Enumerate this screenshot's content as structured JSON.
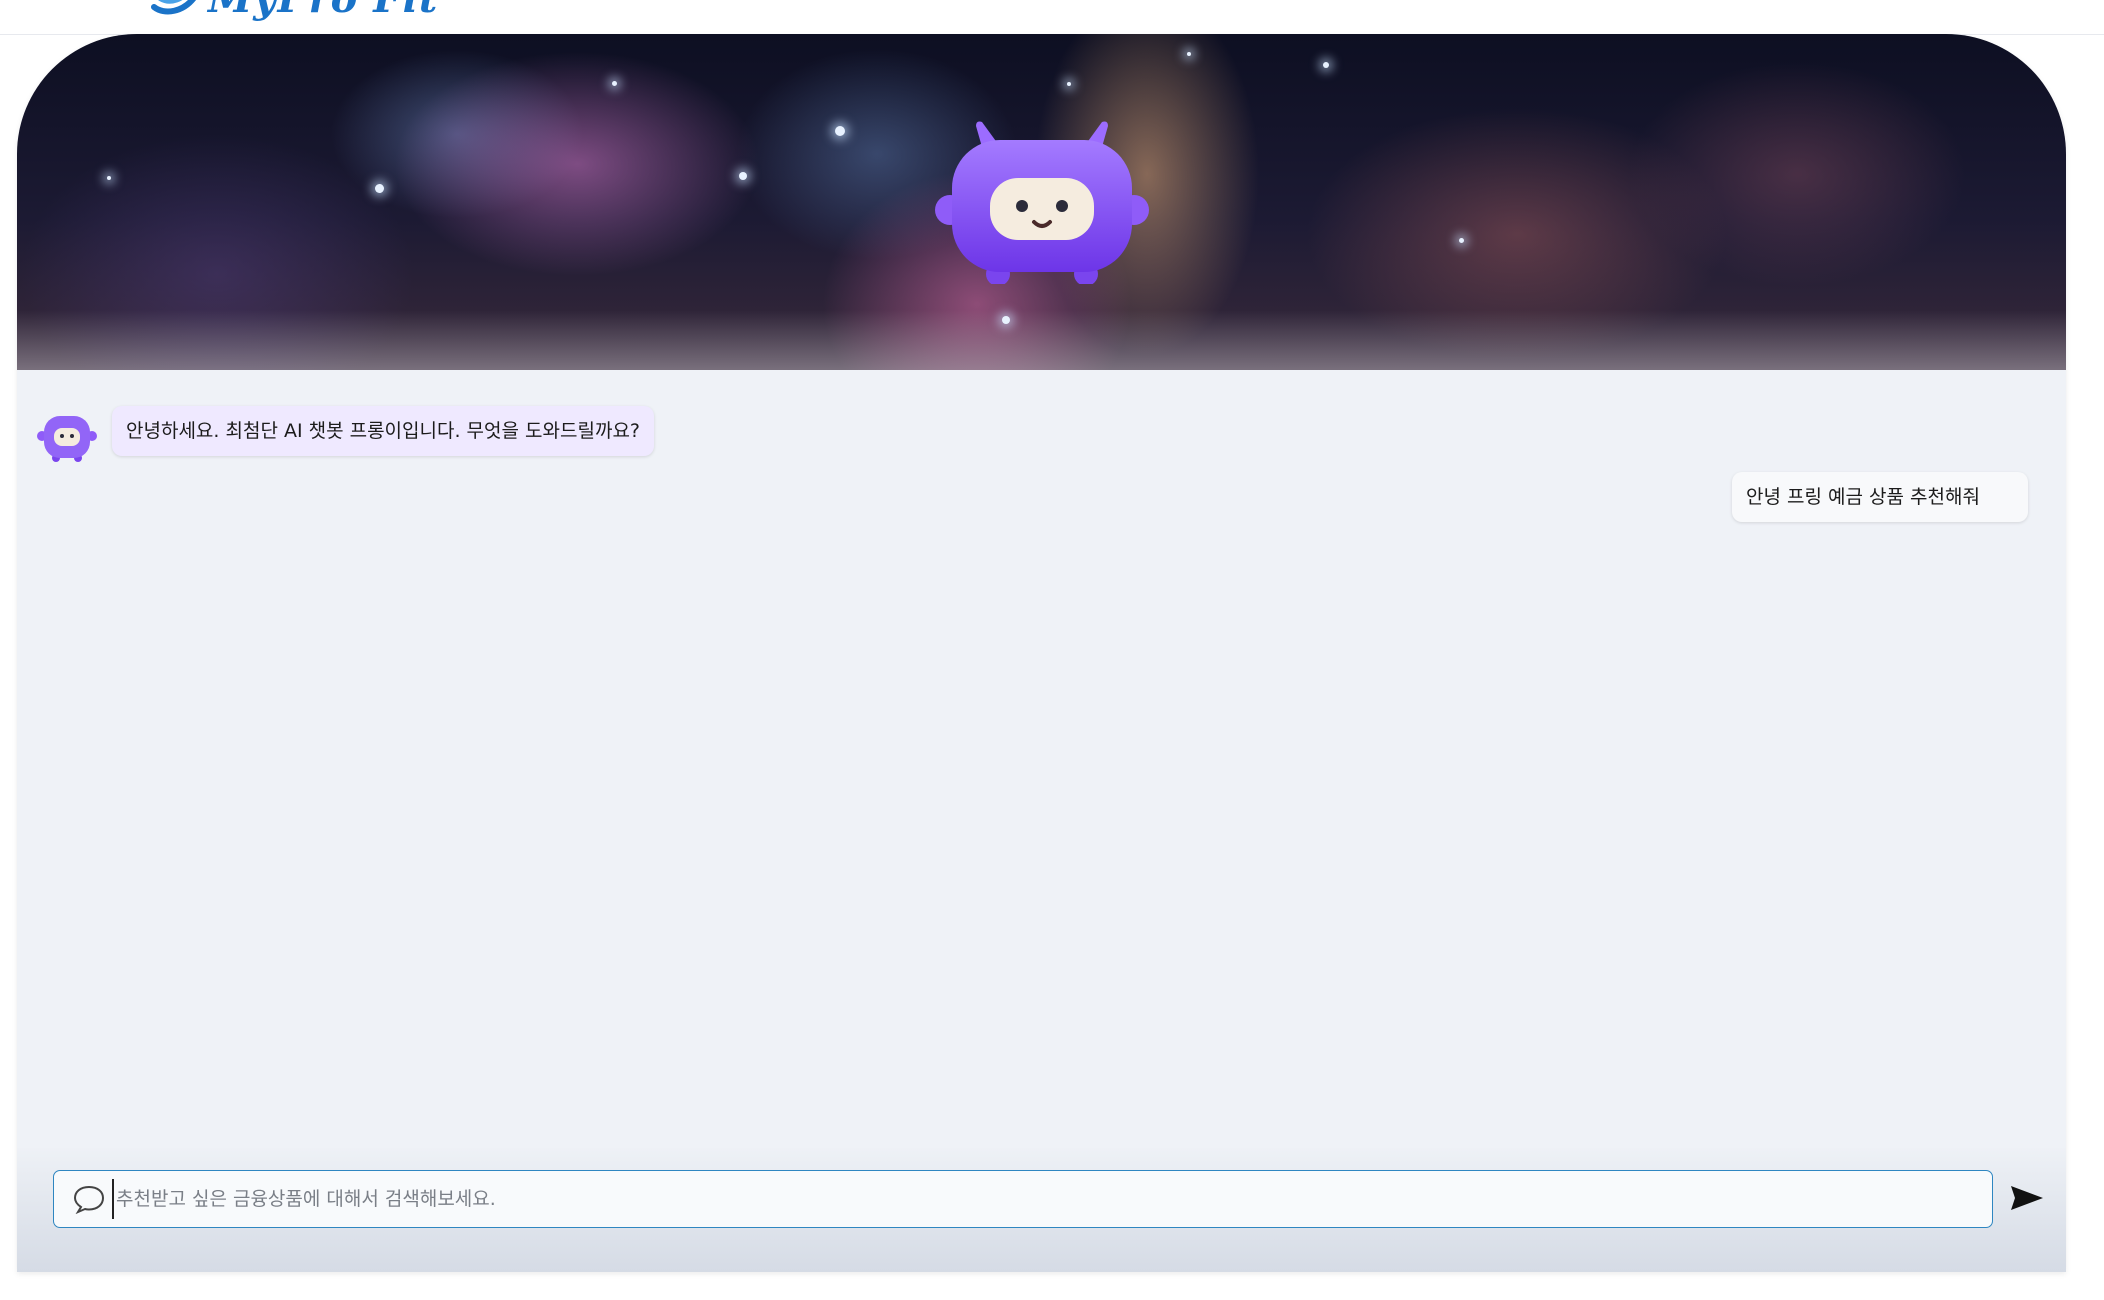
{
  "header": {
    "logo_text": "MyPro Fit",
    "logo_icon": "wave-logo-icon"
  },
  "chat": {
    "bot_avatar_icon": "robot-avatar-icon",
    "messages": [
      {
        "sender": "bot",
        "text": "안녕하세요. 최첨단 AI 챗봇 프롱이입니다. 무엇을 도와드릴까요?"
      },
      {
        "sender": "user",
        "text": "안녕 프링 예금 상품 추천해줘"
      }
    ]
  },
  "input": {
    "placeholder": "추천받고 싶은 금융상품에 대해서 검색해보세요.",
    "value": "",
    "chat_icon": "speech-bubble-icon",
    "send_icon": "send-icon"
  },
  "colors": {
    "accent": "#2e86c1",
    "bot_bubble": "#efe9ff",
    "user_bubble": "#f8f9fb",
    "mascot": "#8b5cf6",
    "logo": "#1a73c8"
  }
}
